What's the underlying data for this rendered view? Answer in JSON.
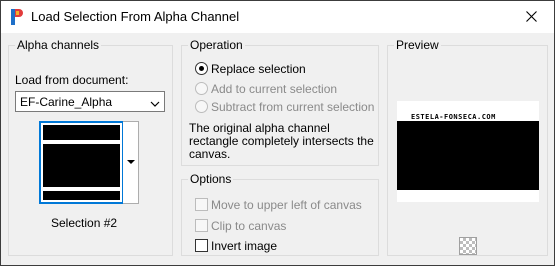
{
  "window": {
    "title": "Load Selection From Alpha Channel",
    "icon": "app-icon"
  },
  "alpha_channels": {
    "group_label": "Alpha channels",
    "load_from_label": "Load from document:",
    "document_value": "EF-Carine_Alpha",
    "selection_label": "Selection #2"
  },
  "operation": {
    "group_label": "Operation",
    "options": [
      {
        "label": "Replace selection",
        "checked": true,
        "enabled": true
      },
      {
        "label": "Add to current selection",
        "checked": false,
        "enabled": false
      },
      {
        "label": "Subtract from current selection",
        "checked": false,
        "enabled": false
      }
    ],
    "info_text_1": "The original alpha channel",
    "info_text_2": "rectangle completely intersects the",
    "info_text_3": "canvas."
  },
  "options": {
    "group_label": "Options",
    "items": [
      {
        "label": "Move to upper left of canvas",
        "checked": false,
        "enabled": false
      },
      {
        "label": "Clip to canvas",
        "checked": false,
        "enabled": false
      },
      {
        "label": "Invert image",
        "checked": false,
        "enabled": true
      }
    ]
  },
  "preview": {
    "group_label": "Preview",
    "watermark": "ESTELA-FONSECA.COM"
  },
  "colors": {
    "accent": "#0078d7",
    "background": "#f0f0f0"
  }
}
